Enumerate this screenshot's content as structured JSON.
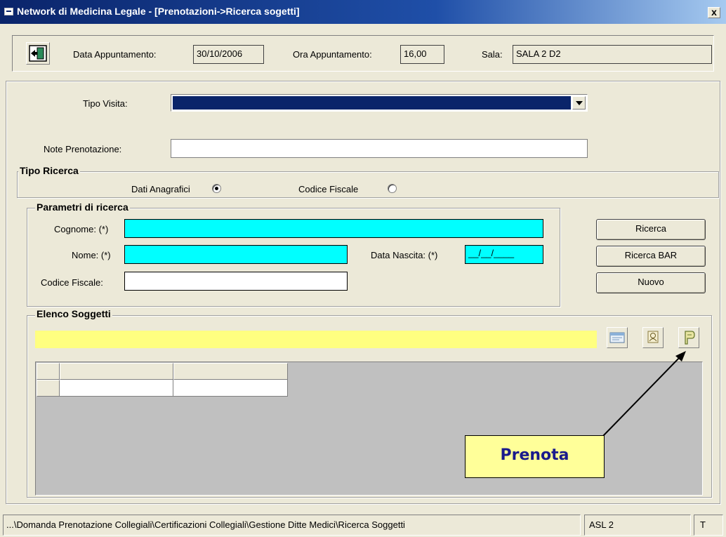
{
  "window": {
    "title": "Network di Medicina Legale - [Prenotazioni->Ricerca sogetti]",
    "close_label": "x"
  },
  "header": {
    "data_appuntamento_label": "Data Appuntamento:",
    "data_appuntamento_value": "30/10/2006",
    "ora_appuntamento_label": "Ora Appuntamento:",
    "ora_appuntamento_value": "16,00",
    "sala_label": "Sala:",
    "sala_value": "SALA 2 D2"
  },
  "visita": {
    "tipo_visita_label": "Tipo Visita:",
    "tipo_visita_value": "",
    "note_label": "Note Prenotazione:",
    "note_value": ""
  },
  "tipo_ricerca": {
    "title": "Tipo Ricerca",
    "option_anagrafici": "Dati Anagrafici",
    "option_codice_fiscale": "Codice Fiscale",
    "selected": "Dati Anagrafici"
  },
  "parametri": {
    "title": "Parametri di ricerca",
    "cognome_label": "Cognome: (*)",
    "cognome_value": "",
    "nome_label": "Nome: (*)",
    "nome_value": "",
    "data_nascita_label": "Data Nascita: (*)",
    "data_nascita_value": "__/__/____",
    "codice_fiscale_label": "Codice Fiscale:",
    "codice_fiscale_value": ""
  },
  "buttons": {
    "ricerca": "Ricerca",
    "ricerca_bar": "Ricerca BAR",
    "nuovo": "Nuovo"
  },
  "elenco": {
    "title": "Elenco Soggetti",
    "filter_value": "",
    "icons": [
      "card-icon",
      "person-icon",
      "prenota-icon"
    ]
  },
  "callout": {
    "label": "Prenota"
  },
  "statusbar": {
    "path": "...\\Domanda Prenotazione Collegiali\\Certificazioni Collegiali\\Gestione Ditte Medici\\Ricerca Soggetti",
    "asl": "ASL 2",
    "mode": "T"
  }
}
